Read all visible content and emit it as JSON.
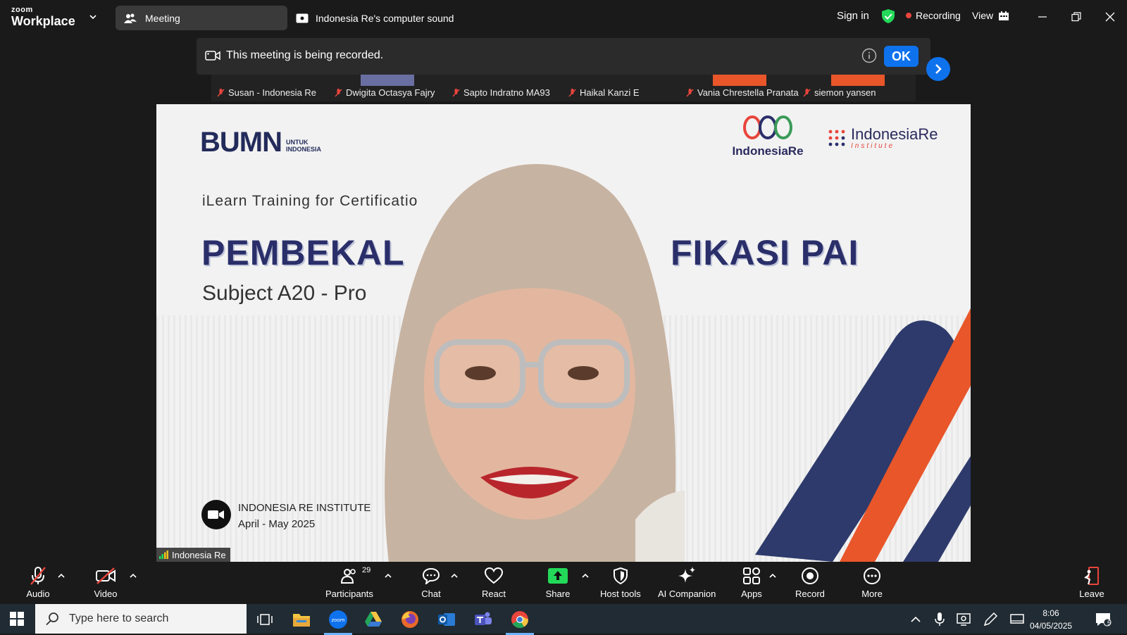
{
  "app": {
    "logo_line1": "zoom",
    "logo_line2": "Workplace",
    "tab_meeting": "Meeting",
    "tab_sound": "Indonesia Re's computer sound",
    "sign_in": "Sign in",
    "recording": "Recording",
    "view": "View"
  },
  "banner": {
    "message": "This meeting is being recorded.",
    "ok": "OK"
  },
  "participants": [
    {
      "name": "Susan - Indonesia Re"
    },
    {
      "name": "Dwigita Octasya Fajry"
    },
    {
      "name": "Sapto Indratno MA93"
    },
    {
      "name": "Haikal Kanzi E"
    },
    {
      "name": "Vania Chrestella Pranata"
    },
    {
      "name": "siemon yansen"
    }
  ],
  "slide": {
    "bumn_big": "BUMN",
    "bumn_small_1": "UNTUK",
    "bumn_small_2": "INDONESIA",
    "ire_label": "IndonesiaRe",
    "iri_label": "IndonesiaRe",
    "iri_sub": "Institute",
    "ilearn": "iLearn Training for Certificatio",
    "title_left": "PEMBEKAL",
    "title_right": "FIKASI PAI",
    "subject": "Subject A20 - Pro",
    "institute": "INDONESIA RE INSTITUTE",
    "period": "April - May 2025"
  },
  "speaker": "Indonesia Re",
  "toolbar": {
    "audio": "Audio",
    "video": "Video",
    "participants": "Participants",
    "participants_count": "29",
    "chat": "Chat",
    "react": "React",
    "share": "Share",
    "host_tools": "Host tools",
    "ai_companion": "AI Companion",
    "apps": "Apps",
    "record": "Record",
    "more": "More",
    "leave": "Leave"
  },
  "taskbar": {
    "search_placeholder": "Type here to search",
    "time": "8:06",
    "date": "04/05/2025",
    "notif_count": "5"
  },
  "colors": {
    "accent": "#0e72ed",
    "recording": "#e8453c",
    "share_green": "#23d959",
    "slide_navy": "#2a2f6a",
    "slide_orange": "#e8562a"
  }
}
